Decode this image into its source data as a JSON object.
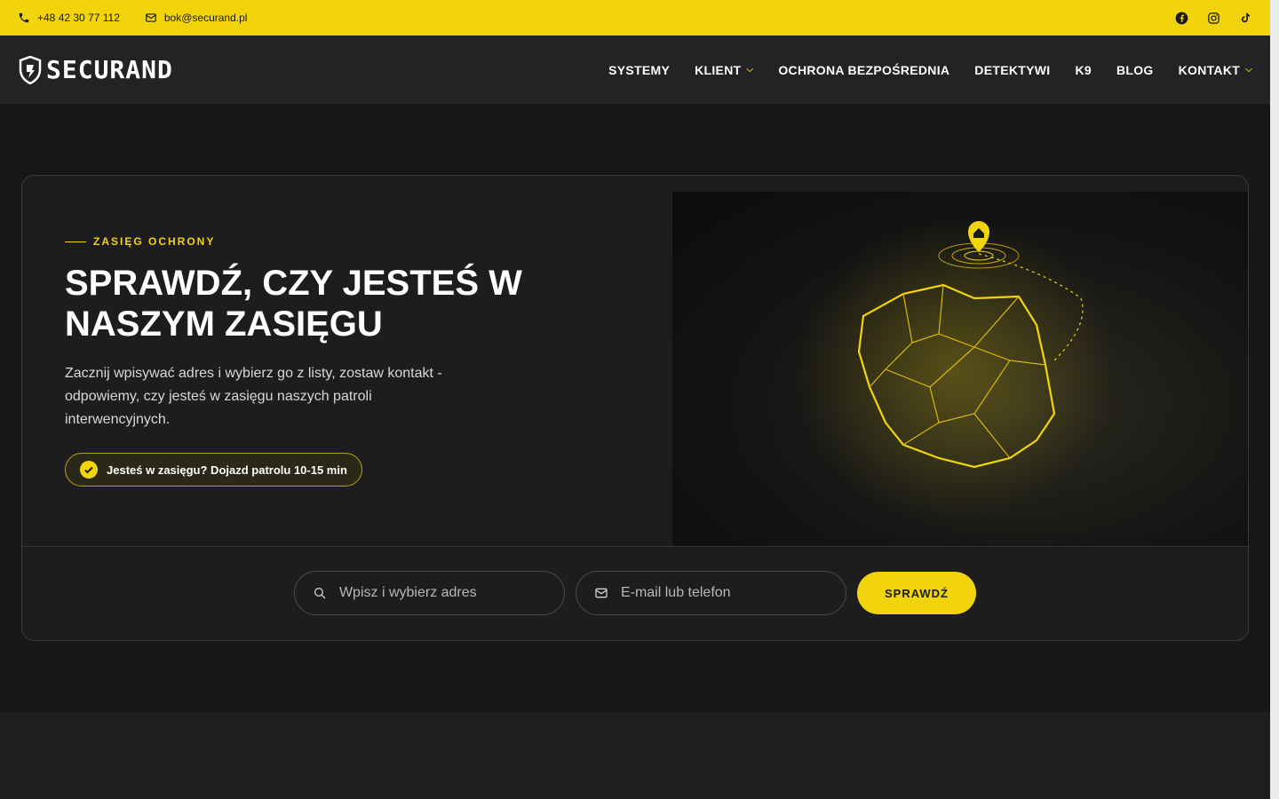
{
  "topbar": {
    "phone": "+48 42 30 77 112",
    "email": "bok@securand.pl",
    "socials": [
      "facebook-icon",
      "instagram-icon",
      "tiktok-icon"
    ]
  },
  "header": {
    "logo_text": "SECURAND",
    "nav": [
      {
        "label": "SYSTEMY",
        "dropdown": false
      },
      {
        "label": "KLIENT",
        "dropdown": true
      },
      {
        "label": "OCHRONA BEZPOŚREDNIA",
        "dropdown": false
      },
      {
        "label": "DETEKTYWI",
        "dropdown": false
      },
      {
        "label": "K9",
        "dropdown": false
      },
      {
        "label": "BLOG",
        "dropdown": false
      },
      {
        "label": "KONTAKT",
        "dropdown": true
      }
    ]
  },
  "hero": {
    "eyebrow": "ZASIĘG OCHRONY",
    "title": "SPRAWDŹ, CZY JESTEŚ W NASZYM ZASIĘGU",
    "description": "Zacznij wpisywać adres i wybierz go z listy, zostaw kontakt - odpowiemy, czy jesteś w zasięgu naszych patroli interwencyjnych.",
    "badge": "Jesteś w zasięgu? Dojazd patrolu 10-15 min"
  },
  "form": {
    "address_placeholder": "Wpisz i wybierz adres",
    "contact_placeholder": "E-mail lub telefon",
    "submit_label": "SPRAWDŹ"
  },
  "colors": {
    "accent": "#f2d40c",
    "background": "#17171a",
    "card": "#1d1d20"
  }
}
